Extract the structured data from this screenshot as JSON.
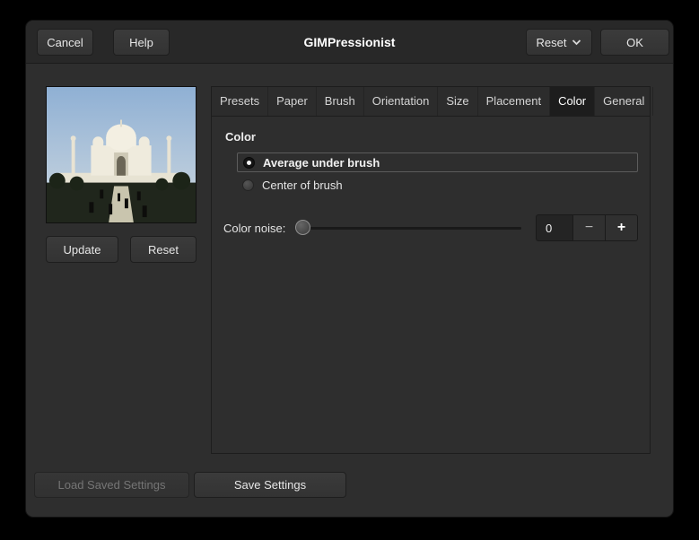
{
  "window": {
    "title": "GIMPressionist"
  },
  "header": {
    "cancel": "Cancel",
    "help": "Help",
    "reset": "Reset",
    "ok": "OK"
  },
  "preview": {
    "update": "Update",
    "reset": "Reset"
  },
  "tabs": [
    {
      "label": "Presets",
      "active": false
    },
    {
      "label": "Paper",
      "active": false
    },
    {
      "label": "Brush",
      "active": false
    },
    {
      "label": "Orientation",
      "active": false
    },
    {
      "label": "Size",
      "active": false
    },
    {
      "label": "Placement",
      "active": false
    },
    {
      "label": "Color",
      "active": true
    },
    {
      "label": "General",
      "active": false
    }
  ],
  "panel": {
    "heading": "Color",
    "options": [
      {
        "label": "Average under brush",
        "selected": true
      },
      {
        "label": "Center of brush",
        "selected": false
      }
    ],
    "noise": {
      "label": "Color noise:",
      "value": "0",
      "minus": "−",
      "plus": "+"
    }
  },
  "footer": {
    "load": "Load Saved Settings",
    "save": "Save Settings"
  },
  "colors": {
    "dialog_bg": "#2e2e2e",
    "header_bg": "#282828",
    "button_bg": "#373737",
    "active_tab_bg": "#1d1d1d",
    "text": "#e6e6e6",
    "disabled_text": "#757575"
  }
}
